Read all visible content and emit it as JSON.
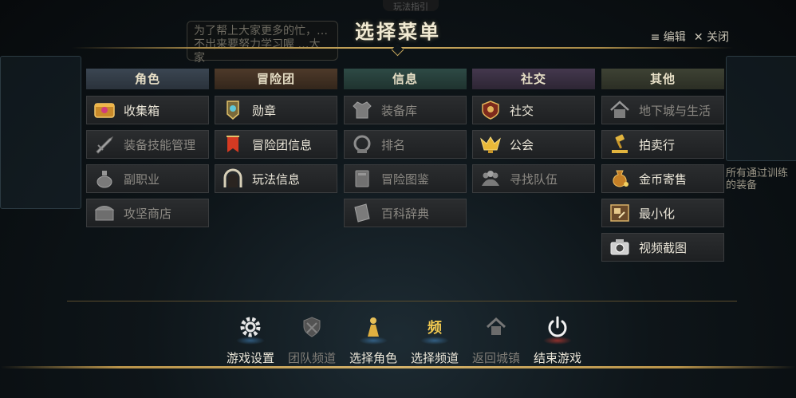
{
  "background": {
    "hint_top": "玩法指引",
    "hint_box": "为了帮上大家更多的忙，… 不出来要努力学习喔 …大家",
    "side_text": "所有通过训练 的装备"
  },
  "header": {
    "title": "选择菜单",
    "edit_label": "≡ 编辑",
    "close_label": "✕ 关闭"
  },
  "columns": [
    {
      "title": "角色",
      "items": [
        {
          "label": "收集箱",
          "icon": "collection-box-icon",
          "enabled": true
        },
        {
          "label": "装备技能管理",
          "icon": "sword-icon",
          "enabled": false
        },
        {
          "label": "副职业",
          "icon": "potion-icon",
          "enabled": false
        },
        {
          "label": "攻坚商店",
          "icon": "chest-icon",
          "enabled": false
        }
      ]
    },
    {
      "title": "冒险团",
      "items": [
        {
          "label": "勋章",
          "icon": "medal-icon",
          "enabled": true
        },
        {
          "label": "冒险团信息",
          "icon": "banner-icon",
          "enabled": true
        },
        {
          "label": "玩法信息",
          "icon": "portal-icon",
          "enabled": true
        }
      ]
    },
    {
      "title": "信息",
      "items": [
        {
          "label": "装备库",
          "icon": "armor-icon",
          "enabled": false
        },
        {
          "label": "排名",
          "icon": "ranking-icon",
          "enabled": false
        },
        {
          "label": "冒险图鉴",
          "icon": "book-icon",
          "enabled": false
        },
        {
          "label": "百科辞典",
          "icon": "encyclopedia-icon",
          "enabled": false
        }
      ]
    },
    {
      "title": "社交",
      "items": [
        {
          "label": "社交",
          "icon": "social-shield-icon",
          "enabled": true
        },
        {
          "label": "公会",
          "icon": "guild-icon",
          "enabled": true
        },
        {
          "label": "寻找队伍",
          "icon": "party-icon",
          "enabled": false
        }
      ]
    },
    {
      "title": "其他",
      "items": [
        {
          "label": "地下城与生活",
          "icon": "house-icon",
          "enabled": false
        },
        {
          "label": "拍卖行",
          "icon": "gavel-icon",
          "enabled": true
        },
        {
          "label": "金币寄售",
          "icon": "gold-bag-icon",
          "enabled": true
        },
        {
          "label": "最小化",
          "icon": "minimize-icon",
          "enabled": true
        },
        {
          "label": "视频截图",
          "icon": "camera-icon",
          "enabled": true
        }
      ]
    }
  ],
  "bottom_bar": [
    {
      "label": "游戏设置",
      "icon": "gear-icon",
      "enabled": true
    },
    {
      "label": "团队频道",
      "icon": "team-shield-icon",
      "enabled": false
    },
    {
      "label": "选择角色",
      "icon": "character-icon",
      "enabled": true
    },
    {
      "label": "选择频道",
      "icon": "channel-icon",
      "enabled": true
    },
    {
      "label": "返回城镇",
      "icon": "town-icon",
      "enabled": false
    },
    {
      "label": "结束游戏",
      "icon": "power-icon",
      "enabled": true
    }
  ],
  "colors": {
    "gold": "#caa95e",
    "text": "#ece7d9",
    "disabled_text": "#8d8a84"
  }
}
